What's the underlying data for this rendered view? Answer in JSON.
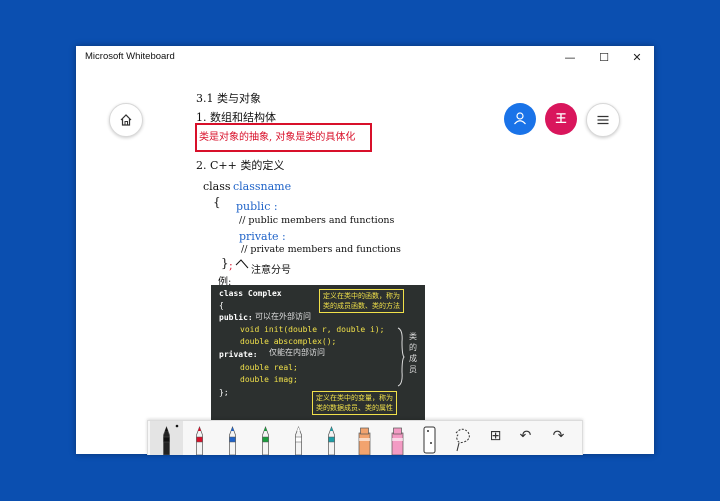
{
  "window": {
    "title": "Microsoft Whiteboard",
    "minimize": "—",
    "maximize": "☐",
    "close": "✕"
  },
  "top_buttons": {
    "home": "⌂",
    "user": "👤",
    "avatar_initial": "王",
    "menu": "☰"
  },
  "notes": {
    "l1": "3.1  类与对象",
    "l2": "1. 数组和结构体",
    "l3": "类是对象的抽象, 对象是类的具体化",
    "l4": "2. C++ 类的定义",
    "l5a": "class",
    "l5b": "classname",
    "l6": "{",
    "l7": "public :",
    "l8": "// public  members  and  functions",
    "l9": "private :",
    "l10": "// private  members  and  functions",
    "l11": "}",
    "l11b": ";",
    "l11c": "注意分号",
    "l12": "例:"
  },
  "code": {
    "lines": [
      "class Complex",
      "{",
      "public:",
      "void init(double r, double i);",
      "double abscomplex();",
      "private:",
      "double real;",
      "double imag;",
      "};"
    ],
    "hw_public": "可以在外部访问",
    "hw_private": "仅能在内部访问",
    "note_top_1": "定义在类中的函数，称为",
    "note_top_2": "类的成员函数、类的方法",
    "note_bottom_1": "定义在类中的变量，称为",
    "note_bottom_2": "类的数据成员、类的属性",
    "hw_side": "类的成员"
  },
  "toolbar": {
    "tools": [
      {
        "name": "ballpoint-pen-black",
        "color": "#111111"
      },
      {
        "name": "pen-red",
        "color": "#d8102a"
      },
      {
        "name": "pen-blue",
        "color": "#1f63c8"
      },
      {
        "name": "pen-green",
        "color": "#1a9c3c"
      },
      {
        "name": "pen-white",
        "color": "#ffffff"
      },
      {
        "name": "pen-teal",
        "color": "#1c9fa8"
      },
      {
        "name": "highlighter-orange",
        "color": "#f2a36e"
      },
      {
        "name": "highlighter-pink",
        "color": "#f39bc4"
      }
    ],
    "eraser": "eraser-icon",
    "lasso": "lasso-icon",
    "add": "⊞",
    "undo": "↶",
    "redo": "↷"
  }
}
